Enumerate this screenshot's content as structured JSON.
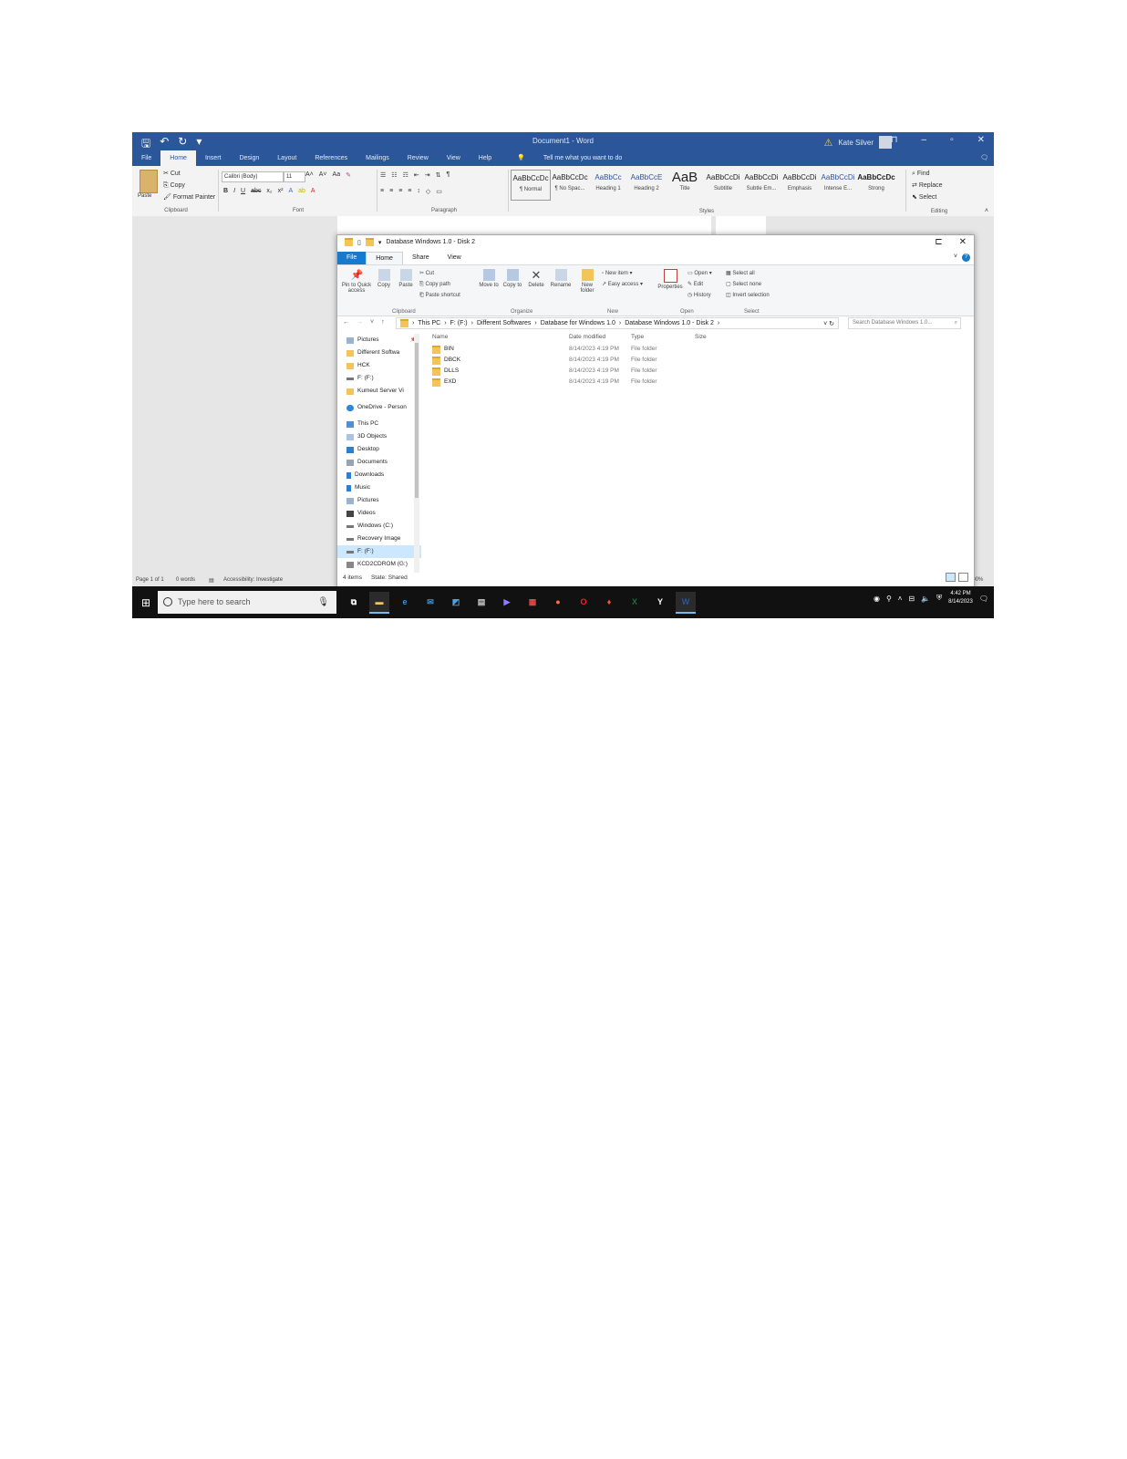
{
  "word": {
    "title": "Document1 - Word",
    "user": "Kate Silver",
    "tabs": [
      "File",
      "Home",
      "Insert",
      "Design",
      "Layout",
      "References",
      "Mailings",
      "Review",
      "View",
      "Help"
    ],
    "tell_me": "Tell me what you want to do",
    "clipboard": {
      "paste": "Paste",
      "cut": "Cut",
      "copy": "Copy",
      "format_painter": "Format Painter",
      "label": "Clipboard"
    },
    "font": {
      "name": "Calibri (Body)",
      "size": "11",
      "label": "Font"
    },
    "paragraph_label": "Paragraph",
    "styles": [
      {
        "preview": "AaBbCcDc",
        "name": "¶ Normal"
      },
      {
        "preview": "AaBbCcDc",
        "name": "¶ No Spac..."
      },
      {
        "preview": "AaBbCc",
        "name": "Heading 1"
      },
      {
        "preview": "AaBbCcE",
        "name": "Heading 2"
      },
      {
        "preview": "AaB",
        "name": "Title"
      },
      {
        "preview": "AaBbCcDi",
        "name": "Subtitle"
      },
      {
        "preview": "AaBbCcDi",
        "name": "Subtle Em..."
      },
      {
        "preview": "AaBbCcDi",
        "name": "Emphasis"
      },
      {
        "preview": "AaBbCcDi",
        "name": "Intense E..."
      },
      {
        "preview": "AaBbCcDc",
        "name": "Strong"
      }
    ],
    "styles_label": "Styles",
    "editing": {
      "find": "Find",
      "replace": "Replace",
      "select": "Select",
      "label": "Editing"
    },
    "status": {
      "page": "Page 1 of 1",
      "words": "0 words",
      "accessibility": "Accessibility: Investigate",
      "zoom": "100%"
    }
  },
  "explorer": {
    "title": "Database Windows 1.0 - Disk 2",
    "tabs": [
      "File",
      "Home",
      "Share",
      "View"
    ],
    "ribbon": {
      "pin": "Pin to Quick access",
      "copy": "Copy",
      "paste": "Paste",
      "cut": "Cut",
      "copy_path": "Copy path",
      "paste_shortcut": "Paste shortcut",
      "clipboard_label": "Clipboard",
      "move_to": "Move to",
      "copy_to": "Copy to",
      "delete": "Delete",
      "rename": "Rename",
      "organize_label": "Organize",
      "new_folder": "New folder",
      "new_item": "New item",
      "easy_access": "Easy access",
      "new_label": "New",
      "properties": "Properties",
      "open": "Open",
      "edit": "Edit",
      "history": "History",
      "open_label": "Open",
      "select_all": "Select all",
      "select_none": "Select none",
      "invert_selection": "Invert selection",
      "select_label": "Select"
    },
    "path": [
      "This PC",
      "F: (F:)",
      "Different Softwares",
      "Database for Windows 1.0",
      "Database Windows 1.0 - Disk 2"
    ],
    "search_placeholder": "Search Database Windows 1.0...",
    "nav": [
      {
        "label": "Pictures",
        "icon": "pictures-icon"
      },
      {
        "label": "Different Softwa",
        "icon": "folder-icon"
      },
      {
        "label": "HCK",
        "icon": "folder-icon"
      },
      {
        "label": "F: (F:)",
        "icon": "drive-icon"
      },
      {
        "label": "Kumeut Server Vi",
        "icon": "folder-icon"
      },
      {
        "label": "OneDrive - Person",
        "icon": "onedrive-icon"
      },
      {
        "label": "This PC",
        "icon": "pc-icon"
      },
      {
        "label": "3D Objects",
        "icon": "3d-objects-icon"
      },
      {
        "label": "Desktop",
        "icon": "desktop-icon"
      },
      {
        "label": "Documents",
        "icon": "documents-icon"
      },
      {
        "label": "Downloads",
        "icon": "downloads-icon"
      },
      {
        "label": "Music",
        "icon": "music-icon"
      },
      {
        "label": "Pictures",
        "icon": "pictures-icon"
      },
      {
        "label": "Videos",
        "icon": "videos-icon"
      },
      {
        "label": "Windows (C:)",
        "icon": "drive-icon"
      },
      {
        "label": "Recovery Image",
        "icon": "drive-icon"
      },
      {
        "label": "F: (F:)",
        "icon": "drive-icon"
      },
      {
        "label": "KCD2CDROM (G:)",
        "icon": "cdrom-icon"
      }
    ],
    "columns": {
      "name": "Name",
      "date": "Date modified",
      "type": "Type",
      "size": "Size"
    },
    "files": [
      {
        "name": "BIN",
        "date": "8/14/2023 4:19 PM",
        "type": "File folder"
      },
      {
        "name": "DBCK",
        "date": "8/14/2023 4:19 PM",
        "type": "File folder"
      },
      {
        "name": "DLLS",
        "date": "8/14/2023 4:19 PM",
        "type": "File folder"
      },
      {
        "name": "EXD",
        "date": "8/14/2023 4:19 PM",
        "type": "File folder"
      }
    ],
    "status": {
      "items": "4 items",
      "state": "State: Shared"
    }
  },
  "taskbar": {
    "search_placeholder": "Type here to search",
    "apps": [
      {
        "label": "Task View",
        "glyph": "⧉",
        "color": "#ffffff"
      },
      {
        "label": "File Explorer",
        "glyph": "▬",
        "color": "#f2c45a"
      },
      {
        "label": "Edge",
        "glyph": "e",
        "color": "#3a96dd"
      },
      {
        "label": "Mail",
        "glyph": "✉",
        "color": "#3a96dd"
      },
      {
        "label": "Photos",
        "glyph": "◩",
        "color": "#4aa3df"
      },
      {
        "label": "Notes",
        "glyph": "▤",
        "color": "#cccccc"
      },
      {
        "label": "Media Player",
        "glyph": "▶",
        "color": "#8a7dff"
      },
      {
        "label": "Calendar",
        "glyph": "▦",
        "color": "#e04b4b"
      },
      {
        "label": "Firefox",
        "glyph": "●",
        "color": "#ff7139"
      },
      {
        "label": "Opera",
        "glyph": "O",
        "color": "#ff1b2d"
      },
      {
        "label": "Brave",
        "glyph": "♦",
        "color": "#fb542b"
      },
      {
        "label": "Excel",
        "glyph": "X",
        "color": "#1d6f42"
      },
      {
        "label": "Yandex",
        "glyph": "Y",
        "color": "#ffffff"
      },
      {
        "label": "Word",
        "glyph": "W",
        "color": "#2b579a"
      }
    ],
    "time": "4:42 PM",
    "date": "8/14/2023"
  }
}
